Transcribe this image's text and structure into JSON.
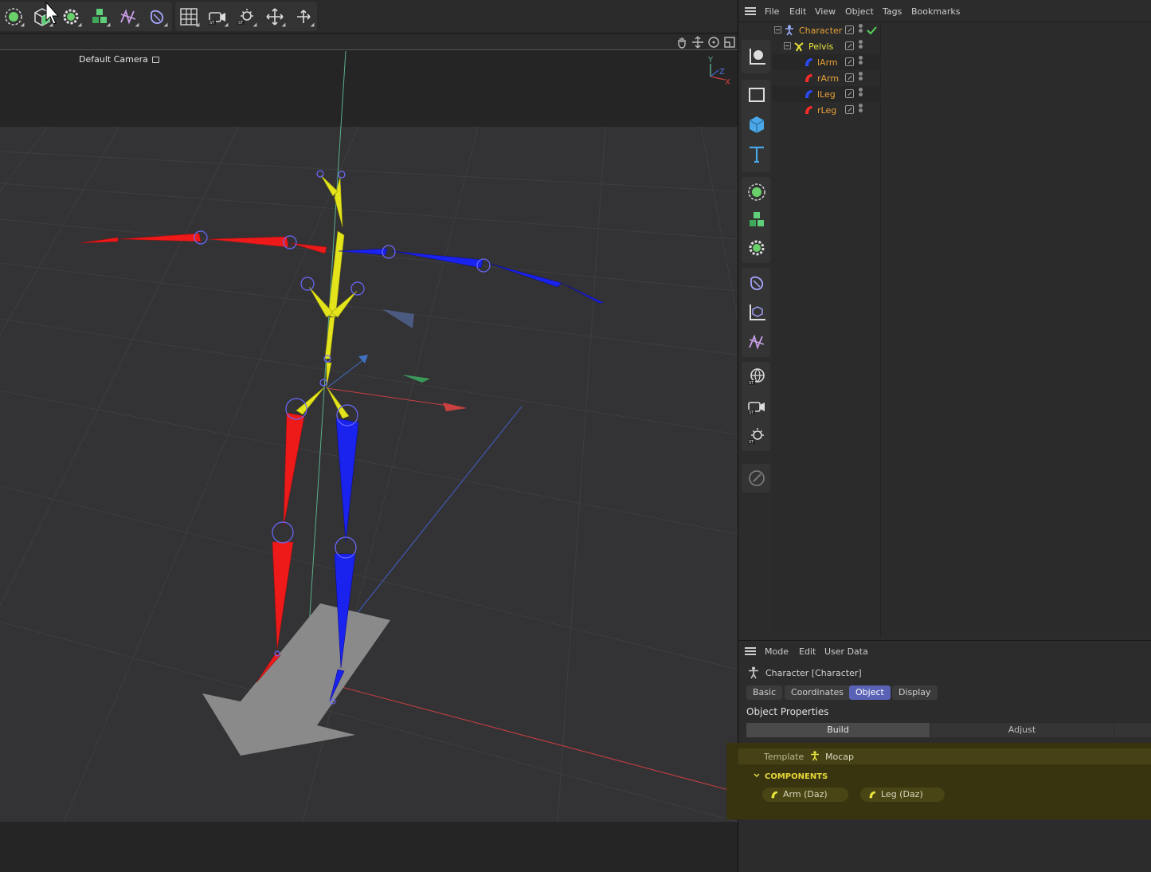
{
  "viewport": {
    "camera_label": "Default Camera"
  },
  "object_manager": {
    "menu": [
      "File",
      "Edit",
      "View",
      "Object",
      "Tags",
      "Bookmarks"
    ],
    "objects": [
      {
        "name": "Character",
        "color": "#e8a23a"
      },
      {
        "name": "Pelvis",
        "color": "#e8e43a"
      },
      {
        "name": "lArm",
        "color": "#e8a23a"
      },
      {
        "name": "rArm",
        "color": "#e8a23a"
      },
      {
        "name": "lLeg",
        "color": "#e8a23a"
      },
      {
        "name": "rLeg",
        "color": "#e8a23a"
      }
    ]
  },
  "attribute_manager": {
    "menu": [
      "Mode",
      "Edit",
      "User Data"
    ],
    "object_title": "Character [Character]",
    "tabs": [
      "Basic",
      "Coordinates",
      "Object",
      "Display"
    ],
    "active_tab": "Object",
    "section_title": "Object Properties",
    "subtabs": [
      "Build",
      "Adjust"
    ],
    "template_label": "Template",
    "template_value": "Mocap",
    "components_label": "COMPONENTS",
    "components": [
      "Arm (Daz)",
      "Leg (Daz)"
    ]
  },
  "colors": {
    "accent": "#5a62b5",
    "left_side": "#1a22ff",
    "right_side": "#ff1a1a",
    "center": "#e8e41a"
  }
}
